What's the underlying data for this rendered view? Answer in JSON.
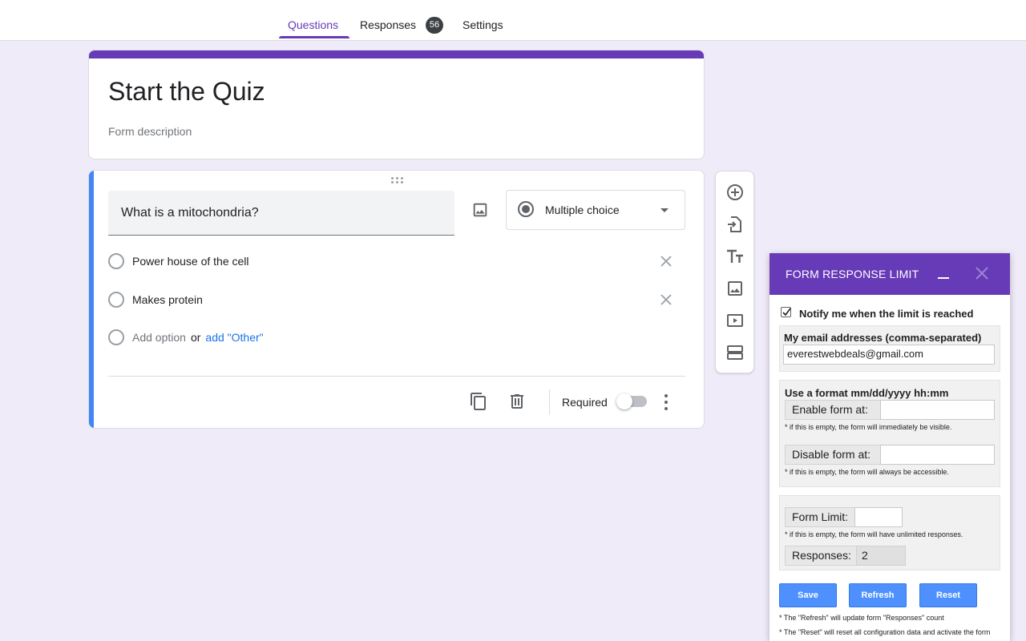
{
  "tabs": [
    {
      "label": "Questions",
      "active": true
    },
    {
      "label": "Responses",
      "badge": "56"
    },
    {
      "label": "Settings"
    }
  ],
  "colors": {
    "accent": "#673ab7",
    "question_stripe": "#4285f4",
    "link": "#1a73e8",
    "panel_button": "#4d90fe",
    "background": "#f0ebf8"
  },
  "form": {
    "title": "Start the Quiz",
    "description_placeholder": "Form description"
  },
  "question": {
    "title": "What is a mitochondria?",
    "type": "Multiple choice",
    "options": [
      "Power house of the cell",
      "Makes protein"
    ],
    "add_option": "Add option",
    "or_text": "or",
    "add_other": "add \"Other\"",
    "required_label": "Required",
    "required": false
  },
  "side_toolbar": [
    "add-question-icon",
    "import-questions-icon",
    "add-title-icon",
    "add-image-icon",
    "add-video-icon",
    "add-section-icon"
  ],
  "panel": {
    "title": "FORM RESPONSE LIMIT",
    "notify": {
      "label": "Notify me when the limit is reached",
      "checked": true
    },
    "email": {
      "label": "My email addresses (comma-separated)",
      "value": "everestwebdeals@gmail.com"
    },
    "schedule": {
      "format_label": "Use a format mm/dd/yyyy hh:mm",
      "enable_label": "Enable form at:",
      "enable_value": "",
      "enable_hint": "* if this is empty, the form will immediately be visible.",
      "disable_label": "Disable form at:",
      "disable_value": "",
      "disable_hint": "* if this is empty, the form will always be accessible."
    },
    "limit": {
      "label": "Form Limit:",
      "value": "",
      "hint": "* if this is empty, the form will have unlimited responses.",
      "responses_label": "Responses:",
      "responses_value": "2"
    },
    "buttons": {
      "save": "Save",
      "refresh": "Refresh",
      "reset": "Reset"
    },
    "notes": [
      "* The \"Refresh\" will update form \"Responses\" count",
      "* The \"Reset\" will reset all configuration data and activate the form"
    ]
  }
}
